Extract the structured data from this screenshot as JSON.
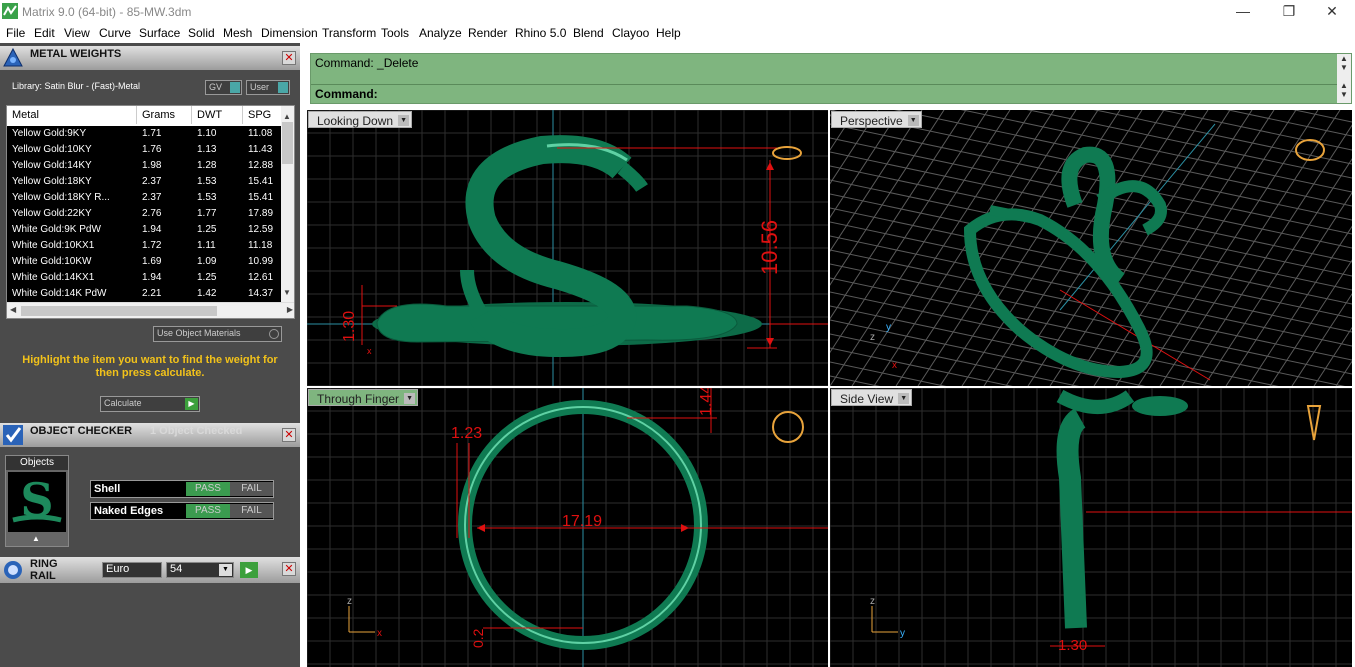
{
  "window": {
    "title": "Matrix 9.0 (64-bit) - 85-MW.3dm",
    "minimize": "—",
    "maximize": "❐",
    "close": "✕"
  },
  "menu": [
    "File",
    "Edit",
    "View",
    "Curve",
    "Surface",
    "Solid",
    "Mesh",
    "Dimension",
    "Transform",
    "Tools",
    "Analyze",
    "Render",
    "Rhino 5.0",
    "Blend",
    "Clayoo",
    "Help"
  ],
  "metal_panel": {
    "title": "METAL WEIGHTS",
    "library": "Library: Satin Blur - (Fast)-Metal",
    "gv": "GV",
    "user": "User",
    "columns": [
      "Metal",
      "Grams",
      "DWT",
      "SPG"
    ],
    "rows": [
      [
        "Yellow Gold:9KY",
        "1.71",
        "1.10",
        "11.08"
      ],
      [
        "Yellow Gold:10KY",
        "1.76",
        "1.13",
        "11.43"
      ],
      [
        "Yellow Gold:14KY",
        "1.98",
        "1.28",
        "12.88"
      ],
      [
        "Yellow Gold:18KY",
        "2.37",
        "1.53",
        "15.41"
      ],
      [
        "Yellow Gold:18KY R...",
        "2.37",
        "1.53",
        "15.41"
      ],
      [
        "Yellow Gold:22KY",
        "2.76",
        "1.77",
        "17.89"
      ],
      [
        "White Gold:9K PdW",
        "1.94",
        "1.25",
        "12.59"
      ],
      [
        "White Gold:10KX1",
        "1.72",
        "1.11",
        "11.18"
      ],
      [
        "White Gold:10KW",
        "1.69",
        "1.09",
        "10.99"
      ],
      [
        "White Gold:14KX1",
        "1.94",
        "1.25",
        "12.61"
      ],
      [
        "White Gold:14K PdW",
        "2.21",
        "1.42",
        "14.37"
      ]
    ],
    "use_object_materials": "Use Object Materials",
    "hint": "Highlight the item you want to find the weight for then press calculate.",
    "calculate": "Calculate"
  },
  "object_checker": {
    "title": "OBJECT CHECKER",
    "status": "1  Object Checked",
    "objects_label": "Objects",
    "checks": [
      {
        "name": "Shell",
        "pass": "PASS",
        "fail": "FAIL"
      },
      {
        "name": "Naked Edges",
        "pass": "PASS",
        "fail": "FAIL"
      }
    ]
  },
  "ring_rail": {
    "title": "RING RAIL",
    "size_system": "Euro",
    "size": "54"
  },
  "command": {
    "line1": "Command: _Delete",
    "line2": "Command:"
  },
  "viewports": [
    {
      "label": "Looking Down",
      "dims": [
        "10.56",
        "1.30"
      ]
    },
    {
      "label": "Perspective"
    },
    {
      "label": "Through Finger",
      "dims": [
        "1.23",
        "1.44",
        "17.19",
        "0.2"
      ]
    },
    {
      "label": "Side View",
      "dims": [
        "1.30"
      ]
    }
  ],
  "colors": {
    "accent": "#7fb57f",
    "metal": "#0f7a52",
    "dim": "#e01010"
  }
}
